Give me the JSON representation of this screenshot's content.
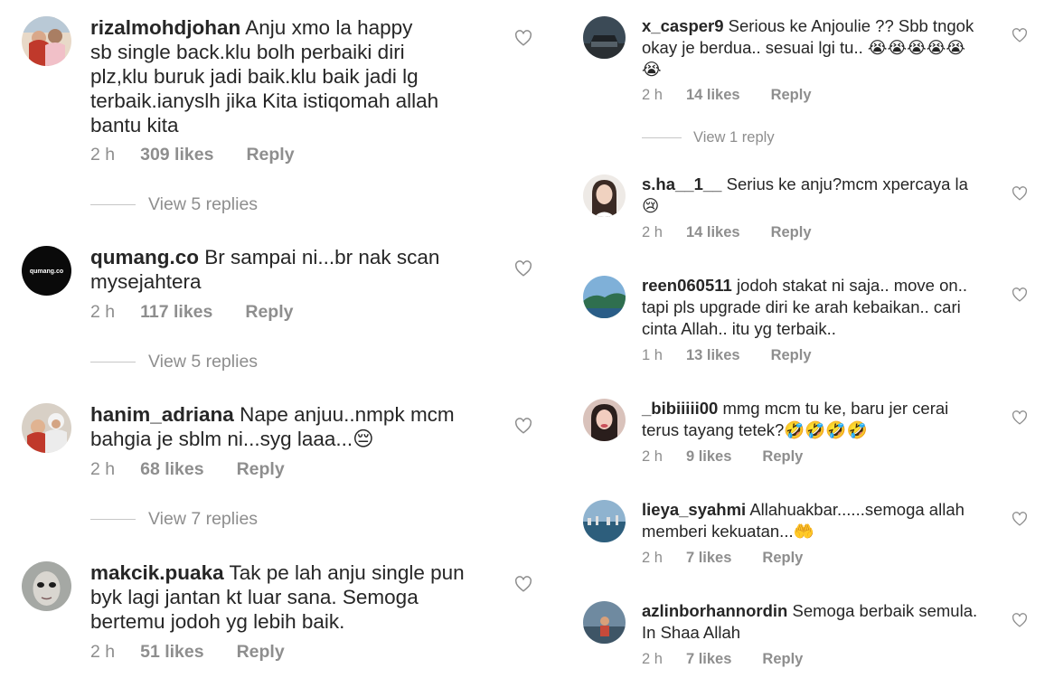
{
  "left_comments": [
    {
      "username": "rizalmohdjohan",
      "text": "Anju xmo la happy\nsb single back.klu bolh perbaiki diri\nplz,klu buruk jadi baik.klu baik jadi lg\nterbaik.ianyslh jika Kita istiqomah allah\nbantu kita",
      "time": "2 h",
      "likes": "309 likes",
      "reply": "Reply",
      "view_replies": "View 5 replies",
      "avatar_icon": "couple-photo"
    },
    {
      "username": "qumang.co",
      "text": "Br sampai ni...br nak scan\nmysejahtera",
      "time": "2 h",
      "likes": "117 likes",
      "reply": "Reply",
      "view_replies": "View 5 replies",
      "avatar_icon": "brand-logo",
      "avatar_text": "qumang.co"
    },
    {
      "username": "hanim_adriana",
      "text": "Nape anjuu..nmpk mcm\nbahgia je sblm ni...syg laaa...😔",
      "time": "2 h",
      "likes": "68 likes",
      "reply": "Reply",
      "view_replies": "View 7 replies",
      "avatar_icon": "family-photo"
    },
    {
      "username": "makcik.puaka",
      "text": "Tak pe lah anju single pun\nbyk lagi jantan kt luar sana. Semoga\nbertemu jodoh yg lebih baik.",
      "time": "2 h",
      "likes": "51 likes",
      "reply": "Reply",
      "avatar_icon": "face-photo"
    }
  ],
  "right_comments": [
    {
      "username": "x_casper9",
      "text": "Serious ke Anjoulie ?? Sbb tngok\nokay je berdua.. sesuai lgi tu.. 😭😭😭😭😭\n😭",
      "time": "2 h",
      "likes": "14 likes",
      "reply": "Reply",
      "view_replies": "View 1 reply",
      "avatar_icon": "car-photo"
    },
    {
      "username": "s.ha__1__",
      "text": "Serius ke anju?mcm xpercaya la\n😢",
      "time": "2 h",
      "likes": "14 likes",
      "reply": "Reply",
      "avatar_icon": "woman-photo"
    },
    {
      "username": "reen060511",
      "text": "jodoh stakat ni saja.. move on..\ntapi pls upgrade diri ke arah kebaikan.. cari\ncinta Allah.. itu yg terbaik..",
      "time": "1 h",
      "likes": "13 likes",
      "reply": "Reply",
      "avatar_icon": "landscape-photo"
    },
    {
      "username": "_bibiiiii00",
      "text": "mmg mcm tu ke, baru jer cerai\nterus tayang tetek?🤣🤣🤣🤣",
      "time": "2 h",
      "likes": "9 likes",
      "reply": "Reply",
      "avatar_icon": "woman-photo"
    },
    {
      "username": "lieya_syahmi",
      "text": "Allahuakbar......semoga allah\nmemberi kekuatan...🤲",
      "time": "2 h",
      "likes": "7 likes",
      "reply": "Reply",
      "avatar_icon": "harbor-photo"
    },
    {
      "username": "azlinborhannordin",
      "text": "Semoga berbaik semula.\nIn Shaa Allah",
      "time": "2 h",
      "likes": "7 likes",
      "reply": "Reply",
      "avatar_icon": "lake-photo"
    }
  ]
}
